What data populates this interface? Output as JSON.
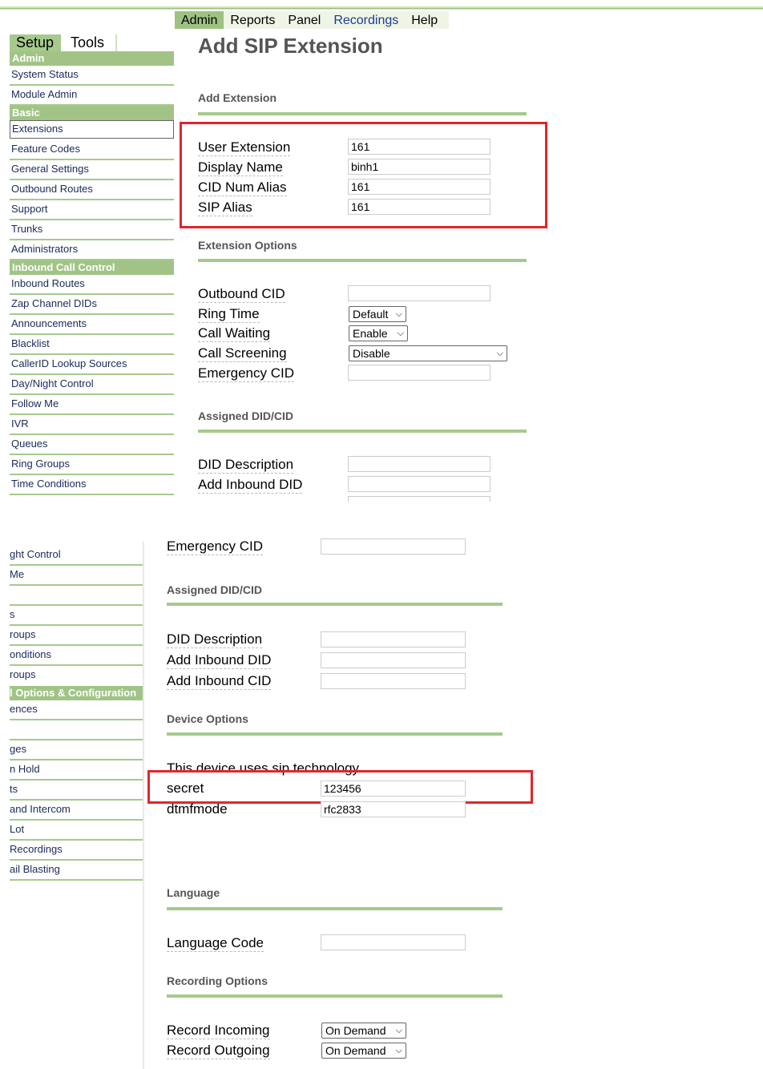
{
  "nav": {
    "items": [
      {
        "label": "Admin",
        "active": true
      },
      {
        "label": "Reports"
      },
      {
        "label": "Panel"
      },
      {
        "label": "Recordings"
      },
      {
        "label": "Help"
      }
    ]
  },
  "tabs": {
    "setup": "Setup",
    "tools": "Tools"
  },
  "page_title": "Add SIP Extension",
  "sidebar": {
    "admin_head": "Admin",
    "admin": [
      "System Status",
      "Module Admin"
    ],
    "basic_head": "Basic",
    "basic": [
      "Extensions",
      "Feature Codes",
      "General Settings",
      "Outbound Routes",
      "Support",
      "Trunks",
      "Administrators"
    ],
    "inbound_head": "Inbound Call Control",
    "inbound": [
      "Inbound Routes",
      "Zap Channel DIDs",
      "Announcements",
      "Blacklist",
      "CallerID Lookup Sources",
      "Day/Night Control",
      "Follow Me",
      "IVR",
      "Queues",
      "Ring Groups",
      "Time Conditions"
    ]
  },
  "sidebar2": {
    "items_a": [
      "ght Control",
      "Me",
      "",
      "s",
      "roups",
      "onditions",
      "roups"
    ],
    "head": "l Options & Configuration",
    "items_b": [
      "ences",
      "",
      "ges",
      "n Hold",
      "ts",
      " and Intercom",
      " Lot",
      " Recordings",
      "ail Blasting"
    ]
  },
  "add_extension": {
    "section": "Add Extension",
    "user_extension_label": "User Extension",
    "user_extension": "161",
    "display_name_label": "Display Name",
    "display_name": "binh1",
    "cid_num_alias_label": "CID Num Alias",
    "cid_num_alias": "161",
    "sip_alias_label": "SIP Alias",
    "sip_alias": "161"
  },
  "extension_options": {
    "section": "Extension Options",
    "outbound_cid_label": "Outbound CID",
    "outbound_cid": "",
    "ring_time_label": "Ring Time",
    "ring_time": "Default",
    "call_waiting_label": "Call Waiting",
    "call_waiting": "Enable",
    "call_screening_label": "Call Screening",
    "call_screening": "Disable",
    "emergency_cid_label": "Emergency CID",
    "emergency_cid": ""
  },
  "assigned": {
    "section": "Assigned DID/CID",
    "did_description_label": "DID Description",
    "add_inbound_did_label": "Add Inbound DID",
    "add_inbound_cid_label": "Add Inbound CID"
  },
  "device_options": {
    "section": "Device Options",
    "note": "This device uses sip technology.",
    "secret_label": "secret",
    "secret": "123456",
    "dtmfmode_label": "dtmfmode",
    "dtmfmode": "rfc2833"
  },
  "language": {
    "section": "Language",
    "language_code_label": "Language Code",
    "language_code": ""
  },
  "recording": {
    "section": "Recording Options",
    "record_incoming_label": "Record Incoming",
    "record_incoming": "On Demand",
    "record_outgoing_label": "Record Outgoing",
    "record_outgoing": "On Demand"
  },
  "colors": {
    "accent_green": "#a1c486",
    "highlight_red": "#e2252b"
  }
}
